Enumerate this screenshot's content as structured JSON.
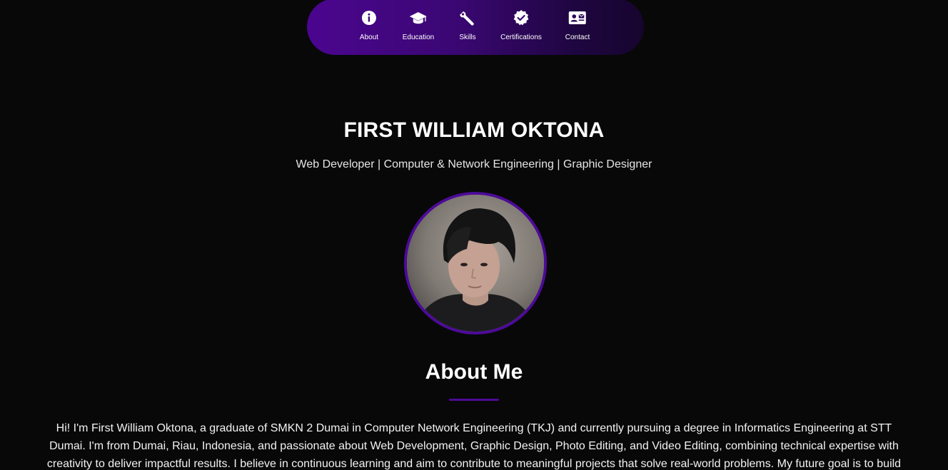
{
  "nav": {
    "items": [
      {
        "label": "About",
        "icon": "info-icon"
      },
      {
        "label": "Education",
        "icon": "graduation-cap-icon"
      },
      {
        "label": "Skills",
        "icon": "wrench-icon"
      },
      {
        "label": "Certifications",
        "icon": "certificate-check-icon"
      },
      {
        "label": "Contact",
        "icon": "contact-card-icon"
      }
    ]
  },
  "hero": {
    "name": "FIRST WILLIAM OKTONA",
    "subtitle": "Web Developer | Computer & Network Engineering | Graphic Designer"
  },
  "about": {
    "title": "About Me",
    "text": "Hi! I'm First William Oktona, a graduate of SMKN 2 Dumai in Computer Network Engineering (TKJ) and currently pursuing a degree in Informatics Engineering at STT Dumai. I'm from Dumai, Riau, Indonesia, and passionate about Web Development, Graphic Design, Photo Editing, and Video Editing, combining technical expertise with creativity to deliver impactful results. I believe in continuous learning and aim to contribute to meaningful projects that solve real-world problems. My future goal is to build"
  },
  "colors": {
    "background": "#080808",
    "accent": "#4d0a99",
    "nav_gradient_start": "#4b058f",
    "nav_gradient_end": "#17052f"
  }
}
